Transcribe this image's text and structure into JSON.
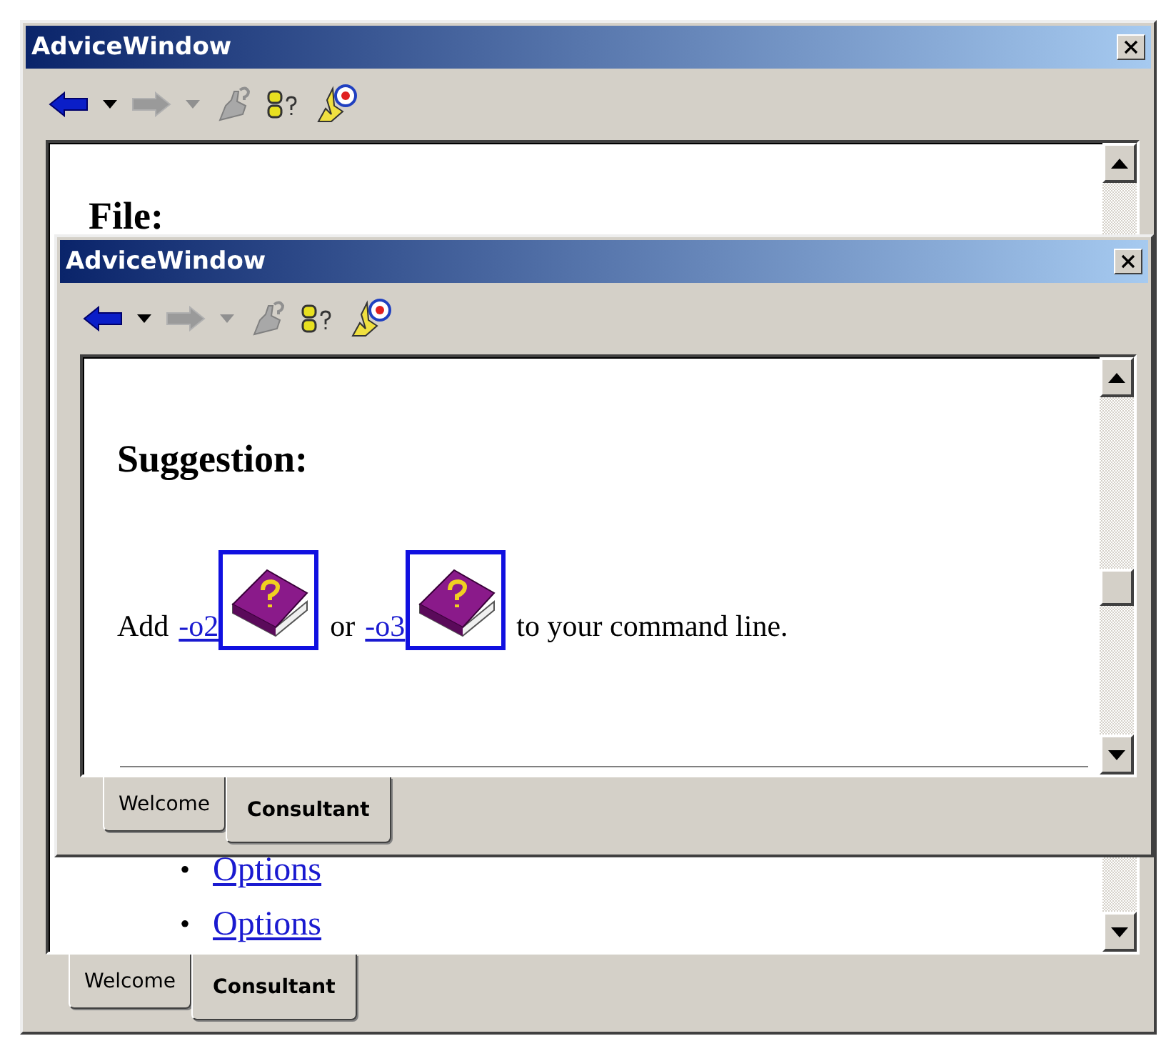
{
  "windows": [
    {
      "title": "AdviceWindow",
      "toolbar": [
        {
          "kind": "back",
          "disabled": false
        },
        {
          "kind": "dropdown",
          "disabled": false
        },
        {
          "kind": "forward",
          "disabled": true
        },
        {
          "kind": "dropdown",
          "disabled": true
        },
        {
          "kind": "ask",
          "disabled": true
        },
        {
          "kind": "help",
          "disabled": false
        },
        {
          "kind": "target",
          "disabled": false
        }
      ],
      "heading": "File:",
      "list": [
        {
          "bullet": "•",
          "text": "Options"
        },
        {
          "bullet": "•",
          "text": "Options"
        }
      ],
      "tabs": [
        {
          "label": "Welcome",
          "selected": false
        },
        {
          "label": "Consultant",
          "selected": true
        }
      ]
    },
    {
      "title": "AdviceWindow",
      "toolbar": [
        {
          "kind": "back",
          "disabled": false
        },
        {
          "kind": "dropdown",
          "disabled": false
        },
        {
          "kind": "forward",
          "disabled": true
        },
        {
          "kind": "dropdown",
          "disabled": true
        },
        {
          "kind": "ask",
          "disabled": true
        },
        {
          "kind": "help",
          "disabled": false
        },
        {
          "kind": "target",
          "disabled": false
        }
      ],
      "heading": "Suggestion:",
      "paragraph": [
        {
          "kind": "text",
          "text": "Add"
        },
        {
          "kind": "link",
          "text": "-o2"
        },
        {
          "kind": "book"
        },
        {
          "kind": "text",
          "text": "or"
        },
        {
          "kind": "link",
          "text": "-o3"
        },
        {
          "kind": "book"
        },
        {
          "kind": "text",
          "text": "to your command line."
        }
      ],
      "tabs": [
        {
          "label": "Welcome",
          "selected": false
        },
        {
          "label": "Consultant",
          "selected": true
        }
      ]
    }
  ]
}
